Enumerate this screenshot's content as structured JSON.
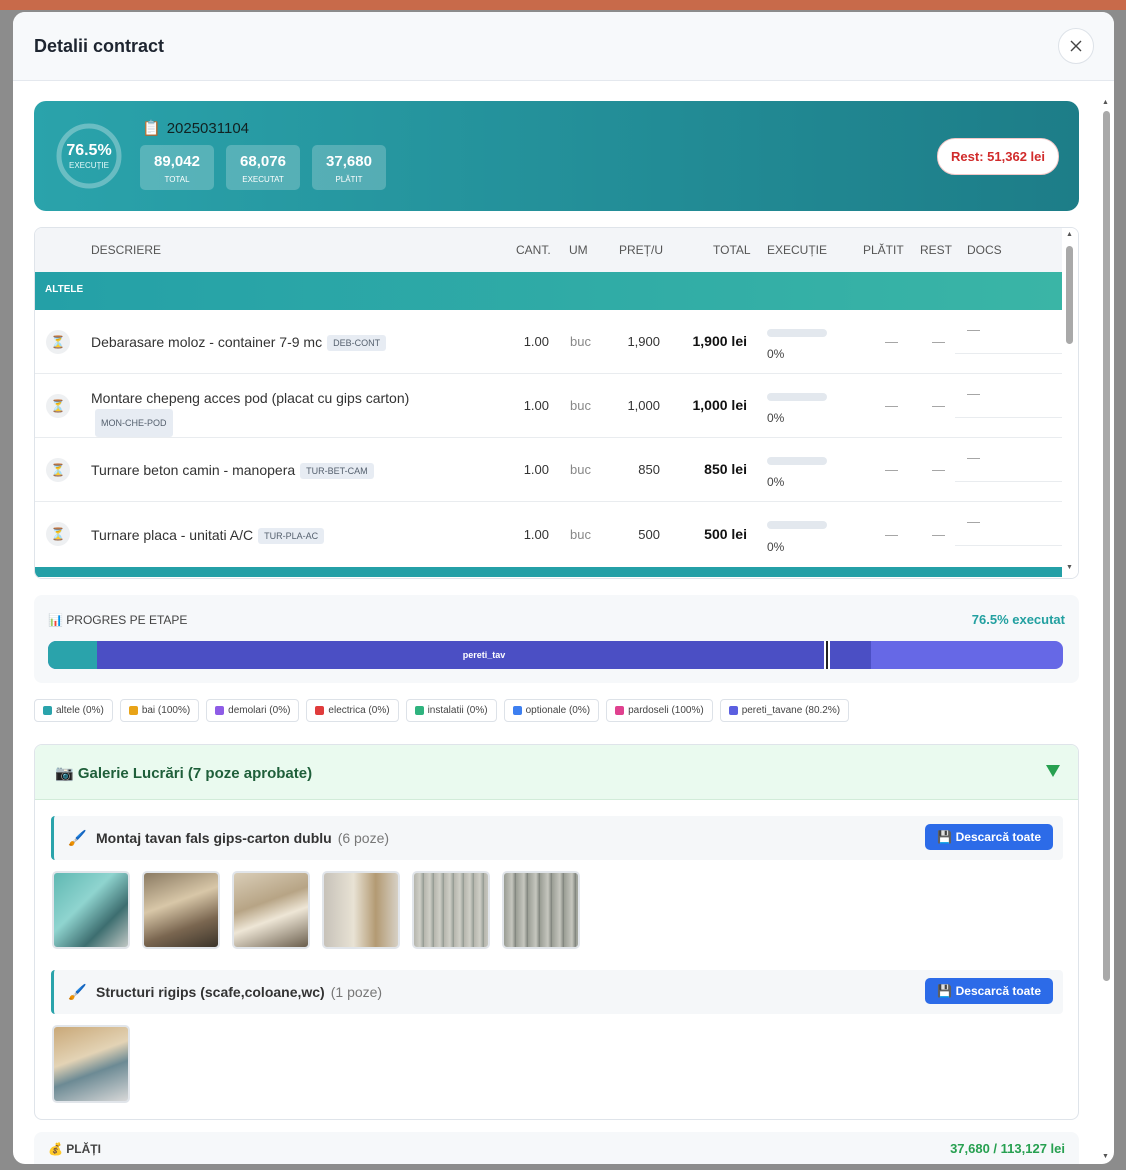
{
  "modal": {
    "title": "Detalii contract"
  },
  "summary": {
    "exec_pct": "76.5%",
    "exec_label": "EXECUȚIE",
    "contract_no": "2025031104",
    "stats": [
      {
        "value": "89,042",
        "label": "TOTAL"
      },
      {
        "value": "68,076",
        "label": "EXECUTAT"
      },
      {
        "value": "37,680",
        "label": "PLĂTIT"
      }
    ],
    "rest": "Rest: 51,362 lei"
  },
  "table": {
    "headers": {
      "desc": "DESCRIERE",
      "cant": "CANT.",
      "um": "UM",
      "pret": "PREȚ/U",
      "total": "TOTAL",
      "exec": "EXECUȚIE",
      "platit": "PLĂTIT",
      "rest": "REST",
      "docs": "DOCS"
    },
    "group": "ALTELE",
    "rows": [
      {
        "desc": "Debarasare moloz - container 7-9 mc",
        "code": "DEB-CONT",
        "cant": "1.00",
        "um": "buc",
        "pret": "1,900",
        "total": "1,900 lei",
        "exec_pct": "0%",
        "exec_fraction": 0,
        "platit": "—",
        "rest": "—",
        "docs": "—"
      },
      {
        "desc": "Montare chepeng acces pod (placat cu gips carton)",
        "code": "MON-CHE-POD",
        "cant": "1.00",
        "um": "buc",
        "pret": "1,000",
        "total": "1,000 lei",
        "exec_pct": "0%",
        "exec_fraction": 0,
        "platit": "—",
        "rest": "—",
        "docs": "—"
      },
      {
        "desc": "Turnare beton camin - manopera",
        "code": "TUR-BET-CAM",
        "cant": "1.00",
        "um": "buc",
        "pret": "850",
        "total": "850 lei",
        "exec_pct": "0%",
        "exec_fraction": 0,
        "platit": "—",
        "rest": "—",
        "docs": "—"
      },
      {
        "desc": "Turnare placa - unitati A/C",
        "code": "TUR-PLA-AC",
        "cant": "1.00",
        "um": "buc",
        "pret": "500",
        "total": "500 lei",
        "exec_pct": "0%",
        "exec_fraction": 0,
        "platit": "—",
        "rest": "—",
        "docs": "—"
      }
    ]
  },
  "progress": {
    "title": "PROGRES PE ETAPE",
    "executed": "76.5% executat",
    "segment_label": "pereti_tav"
  },
  "legend": [
    {
      "label": "altele (0%)",
      "color": "#2aa3ab"
    },
    {
      "label": "bai (100%)",
      "color": "#e8a317"
    },
    {
      "label": "demolari (0%)",
      "color": "#8e5ce6"
    },
    {
      "label": "electrica (0%)",
      "color": "#e03c3c"
    },
    {
      "label": "instalatii (0%)",
      "color": "#2fb37e"
    },
    {
      "label": "optionale (0%)",
      "color": "#3d7ff0"
    },
    {
      "label": "pardoseli (100%)",
      "color": "#e0418f"
    },
    {
      "label": "pereti_tavane (80.2%)",
      "color": "#5b5fe0"
    }
  ],
  "gallery": {
    "title": "Galerie Lucrări (7 poze aprobate)",
    "sections": [
      {
        "title": "Montaj tavan fals gips-carton dublu",
        "count": "(6 poze)",
        "button": "Descarcă toate"
      },
      {
        "title": "Structuri rigips (scafe,coloane,wc)",
        "count": "(1 poze)",
        "button": "Descarcă toate"
      }
    ]
  },
  "payments": {
    "title": "PLĂȚI",
    "amount": "37,680 / 113,127 lei"
  }
}
